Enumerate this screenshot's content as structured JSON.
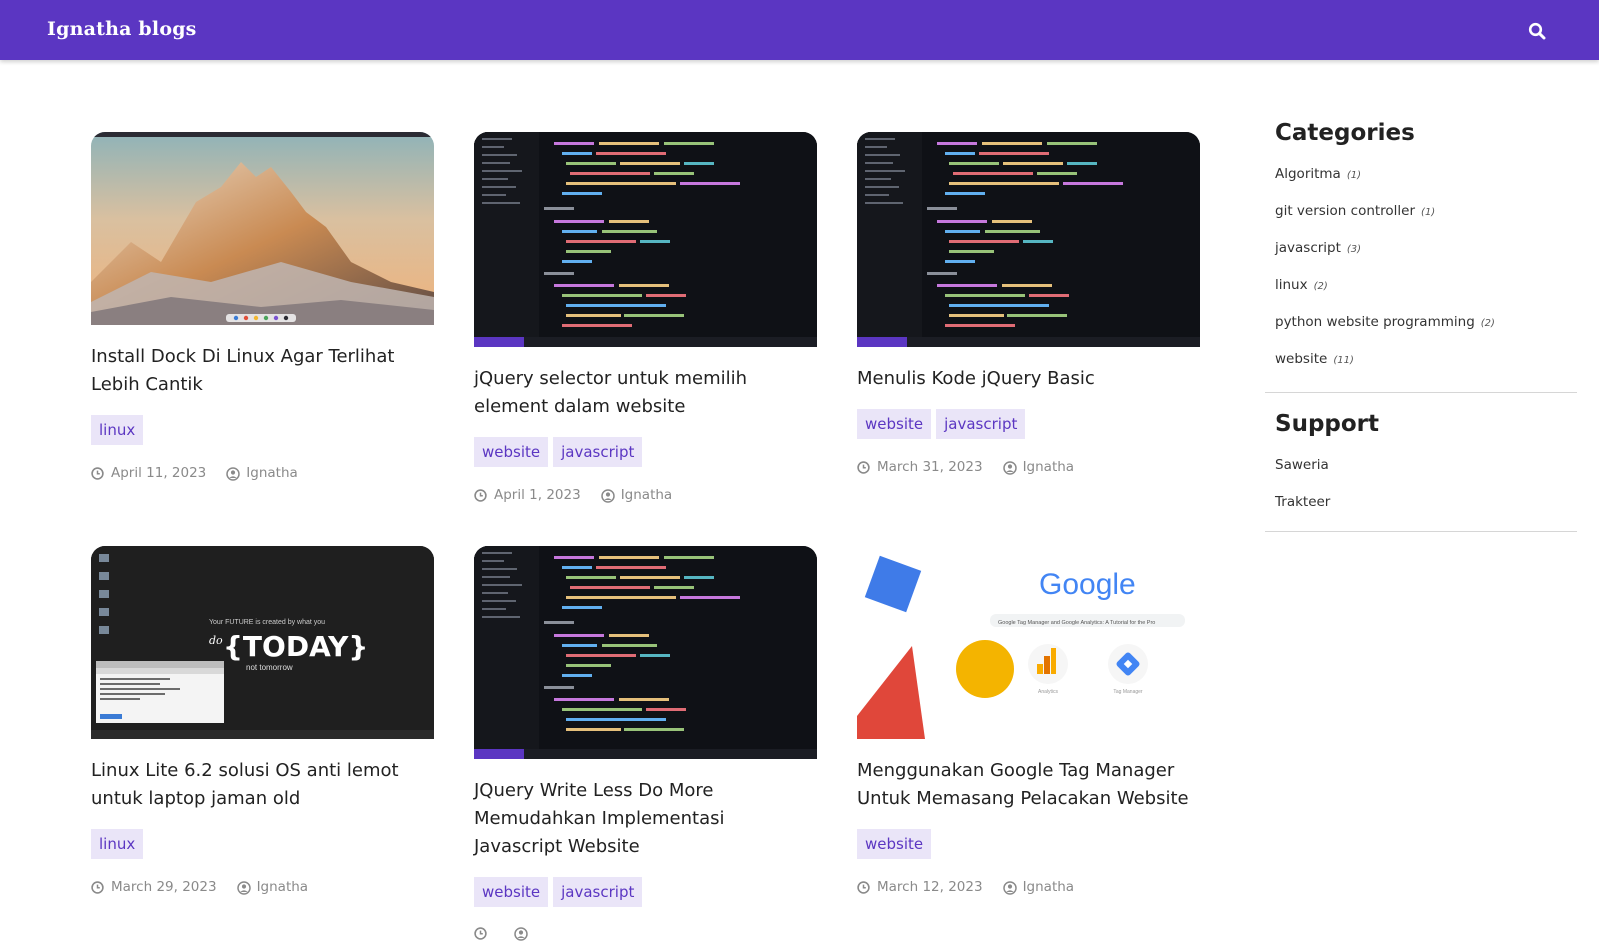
{
  "header": {
    "brand": "Ignatha blogs",
    "search_icon": "search-icon"
  },
  "posts": [
    {
      "title": "Install Dock Di Linux Agar Terlihat Lebih Cantik",
      "tags": [
        "linux"
      ],
      "date": "April 11, 2023",
      "author": "Ignatha"
    },
    {
      "title": "jQuery selector untuk memilih element dalam website",
      "tags": [
        "website",
        "javascript"
      ],
      "date": "April 1, 2023",
      "author": "Ignatha"
    },
    {
      "title": "Menulis Kode jQuery Basic",
      "tags": [
        "website",
        "javascript"
      ],
      "date": "March 31, 2023",
      "author": "Ignatha"
    },
    {
      "title": "Linux Lite 6.2 solusi OS anti lemot untuk laptop jaman old",
      "tags": [
        "linux"
      ],
      "date": "March 29, 2023",
      "author": "Ignatha"
    },
    {
      "title": "JQuery Write Less Do More Memudahkan Implementasi Javascript Website",
      "tags": [
        "website",
        "javascript"
      ],
      "date": "",
      "author": ""
    },
    {
      "title": "Menggunakan Google Tag Manager Untuk Memasang Pelacakan Website",
      "tags": [
        "website"
      ],
      "date": "March 12, 2023",
      "author": "Ignatha"
    }
  ],
  "thumb_text": {
    "linux_lite_line1": "Your FUTURE is created by what you",
    "linux_lite_do": "do",
    "linux_lite_today": "{TODAY}",
    "linux_lite_line3": "not tomorrow",
    "google_logo": "Google",
    "google_search": "Google Tag Manager and Google Analytics: A Tutorial for the Pro",
    "google_analytics": "Analytics",
    "google_tag_manager": "Tag Manager"
  },
  "sidebar": {
    "categories_title": "Categories",
    "categories": [
      {
        "label": "Algoritma",
        "count": "(1)"
      },
      {
        "label": "git version controller",
        "count": "(1)"
      },
      {
        "label": "javascript",
        "count": "(3)"
      },
      {
        "label": "linux",
        "count": "(2)"
      },
      {
        "label": "python website programming",
        "count": "(2)"
      },
      {
        "label": "website",
        "count": "(11)"
      }
    ],
    "support_title": "Support",
    "support": [
      "Saweria",
      "Trakteer"
    ]
  },
  "colors": {
    "brand": "#5b36c2",
    "tag_bg": "#eae5f8"
  }
}
